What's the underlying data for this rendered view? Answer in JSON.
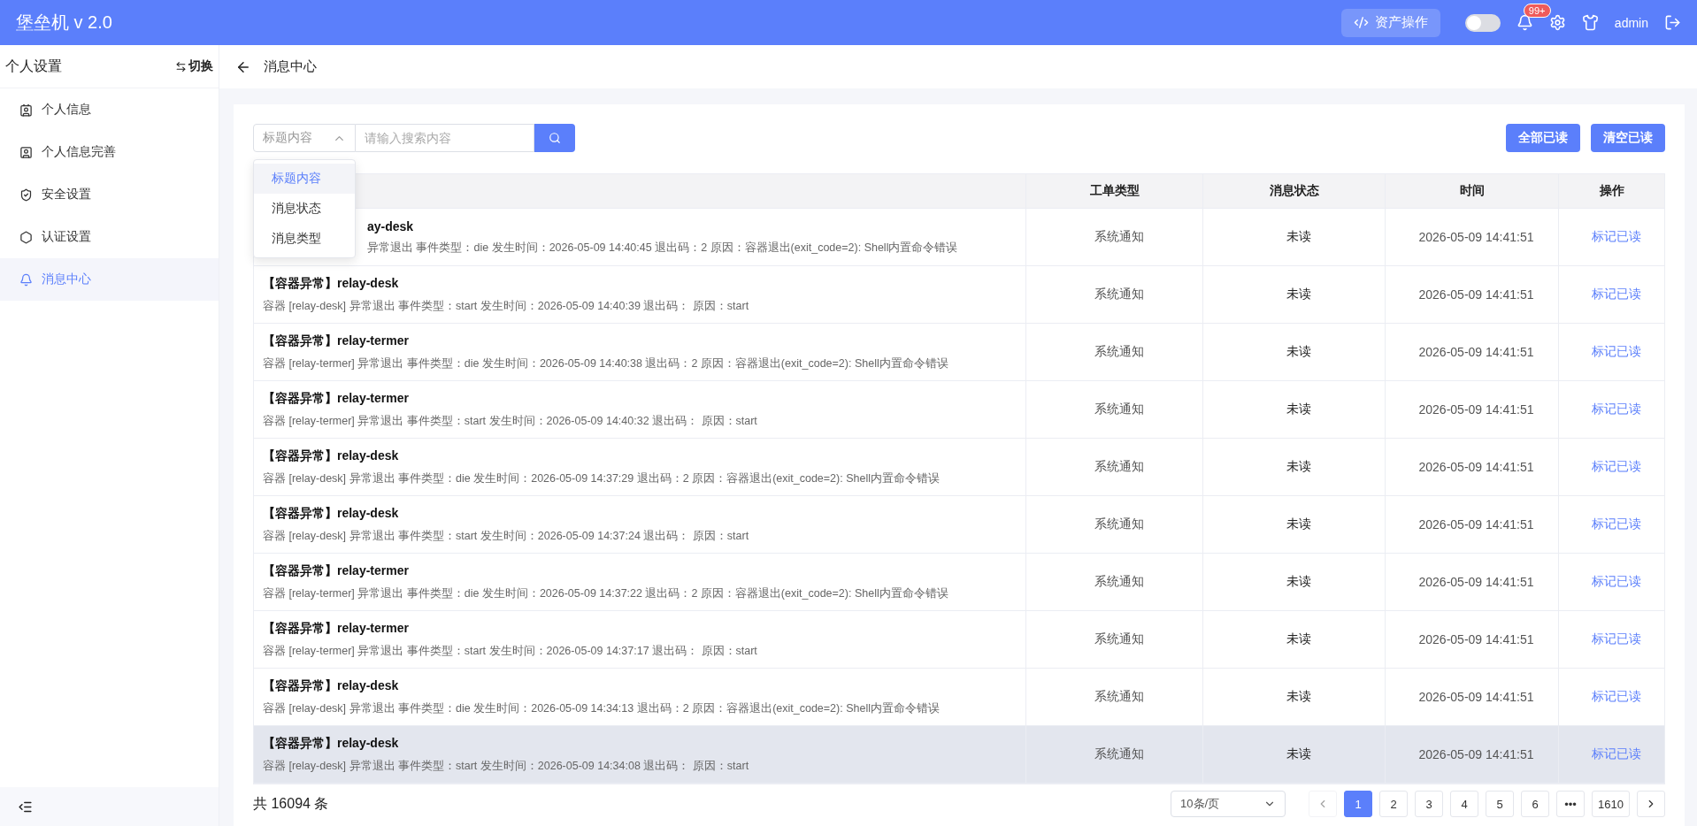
{
  "header": {
    "title": "堡垒机 v 2.0",
    "asset_button": "资产操作",
    "theme_toggle": {
      "on": false
    },
    "notification_badge": "99+",
    "user": "admin"
  },
  "sidebar": {
    "title": "个人设置",
    "switch": "切换",
    "items": [
      {
        "label": "个人信息",
        "selected": false
      },
      {
        "label": "个人信息完善",
        "selected": false
      },
      {
        "label": "安全设置",
        "selected": false
      },
      {
        "label": "认证设置",
        "selected": false
      },
      {
        "label": "消息中心",
        "selected": true
      }
    ]
  },
  "breadcrumb": "消息中心",
  "search": {
    "field_select": "标题内容",
    "placeholder": "请输入搜索内容",
    "dropdown": {
      "open": true,
      "options": [
        {
          "label": "标题内容",
          "selected": true
        },
        {
          "label": "消息状态",
          "selected": false
        },
        {
          "label": "消息类型",
          "selected": false
        }
      ]
    }
  },
  "actions": [
    "全部已读",
    "清空已读"
  ],
  "table": {
    "columns": [
      "工单类型",
      "消息状态",
      "时间",
      "操作"
    ],
    "rows": [
      {
        "title": "ay-desk",
        "detail": "异常退出 事件类型：die 发生时间：2026-05-09 14:40:45 退出码：2 原因：容器退出(exit_code=2): Shell内置命令错误",
        "type": "系统通知",
        "status": "未读",
        "time": "2026-05-09 14:41:51",
        "action": "标记已读",
        "hovered": false
      },
      {
        "title": "【容器异常】relay-desk",
        "detail": "容器 [relay-desk] 异常退出 事件类型：start 发生时间：2026-05-09 14:40:39 退出码： 原因：start",
        "type": "系统通知",
        "status": "未读",
        "time": "2026-05-09 14:41:51",
        "action": "标记已读",
        "hovered": false
      },
      {
        "title": "【容器异常】relay-termer",
        "detail": "容器 [relay-termer] 异常退出 事件类型：die 发生时间：2026-05-09 14:40:38 退出码：2 原因：容器退出(exit_code=2): Shell内置命令错误",
        "type": "系统通知",
        "status": "未读",
        "time": "2026-05-09 14:41:51",
        "action": "标记已读",
        "hovered": false
      },
      {
        "title": "【容器异常】relay-termer",
        "detail": "容器 [relay-termer] 异常退出 事件类型：start 发生时间：2026-05-09 14:40:32 退出码： 原因：start",
        "type": "系统通知",
        "status": "未读",
        "time": "2026-05-09 14:41:51",
        "action": "标记已读",
        "hovered": false
      },
      {
        "title": "【容器异常】relay-desk",
        "detail": "容器 [relay-desk] 异常退出 事件类型：die 发生时间：2026-05-09 14:37:29 退出码：2 原因：容器退出(exit_code=2): Shell内置命令错误",
        "type": "系统通知",
        "status": "未读",
        "time": "2026-05-09 14:41:51",
        "action": "标记已读",
        "hovered": false
      },
      {
        "title": "【容器异常】relay-desk",
        "detail": "容器 [relay-desk] 异常退出 事件类型：start 发生时间：2026-05-09 14:37:24 退出码： 原因：start",
        "type": "系统通知",
        "status": "未读",
        "time": "2026-05-09 14:41:51",
        "action": "标记已读",
        "hovered": false
      },
      {
        "title": "【容器异常】relay-termer",
        "detail": "容器 [relay-termer] 异常退出 事件类型：die 发生时间：2026-05-09 14:37:22 退出码：2 原因：容器退出(exit_code=2): Shell内置命令错误",
        "type": "系统通知",
        "status": "未读",
        "time": "2026-05-09 14:41:51",
        "action": "标记已读",
        "hovered": false
      },
      {
        "title": "【容器异常】relay-termer",
        "detail": "容器 [relay-termer] 异常退出 事件类型：start 发生时间：2026-05-09 14:37:17 退出码： 原因：start",
        "type": "系统通知",
        "status": "未读",
        "time": "2026-05-09 14:41:51",
        "action": "标记已读",
        "hovered": false
      },
      {
        "title": "【容器异常】relay-desk",
        "detail": "容器 [relay-desk] 异常退出 事件类型：die 发生时间：2026-05-09 14:34:13 退出码：2 原因：容器退出(exit_code=2): Shell内置命令错误",
        "type": "系统通知",
        "status": "未读",
        "time": "2026-05-09 14:41:51",
        "action": "标记已读",
        "hovered": false
      },
      {
        "title": "【容器异常】relay-desk",
        "detail": "容器 [relay-desk] 异常退出 事件类型：start 发生时间：2026-05-09 14:34:08 退出码： 原因：start",
        "type": "系统通知",
        "status": "未读",
        "time": "2026-05-09 14:41:51",
        "action": "标记已读",
        "hovered": true
      }
    ]
  },
  "pagination": {
    "total": "共 16094 条",
    "page_size": "10条/页",
    "pages": [
      {
        "label": "1",
        "selected": true
      },
      {
        "label": "2",
        "selected": false
      },
      {
        "label": "3",
        "selected": false
      },
      {
        "label": "4",
        "selected": false
      },
      {
        "label": "5",
        "selected": false
      },
      {
        "label": "6",
        "selected": false
      },
      {
        "label": "•••",
        "selected": false
      },
      {
        "label": "1610",
        "selected": false
      }
    ],
    "prev_disabled": true
  }
}
